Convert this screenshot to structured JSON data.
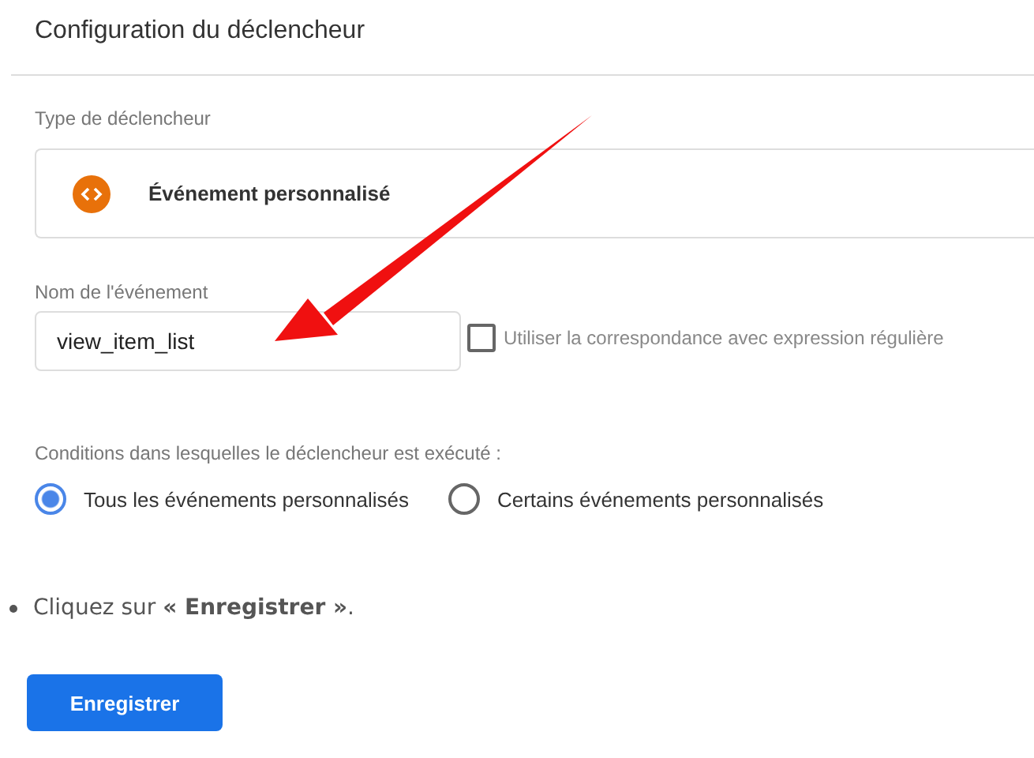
{
  "panel": {
    "title": "Configuration du déclencheur",
    "trigger_type": {
      "label": "Type de déclencheur",
      "value": "Événement personnalisé"
    },
    "event_name": {
      "label": "Nom de l'événement",
      "value": "view_item_list"
    },
    "regex": {
      "label": "Utiliser la correspondance avec expression régulière",
      "checked": false
    },
    "conditions": {
      "label": "Conditions dans lesquelles le déclencheur est exécuté :",
      "options": [
        {
          "label": "Tous les événements personnalisés",
          "selected": true
        },
        {
          "label": "Certains événements personnalisés",
          "selected": false
        }
      ]
    }
  },
  "instruction": "Cliquez sur **« Enregistrer »**.",
  "button": "Enregistrer"
}
